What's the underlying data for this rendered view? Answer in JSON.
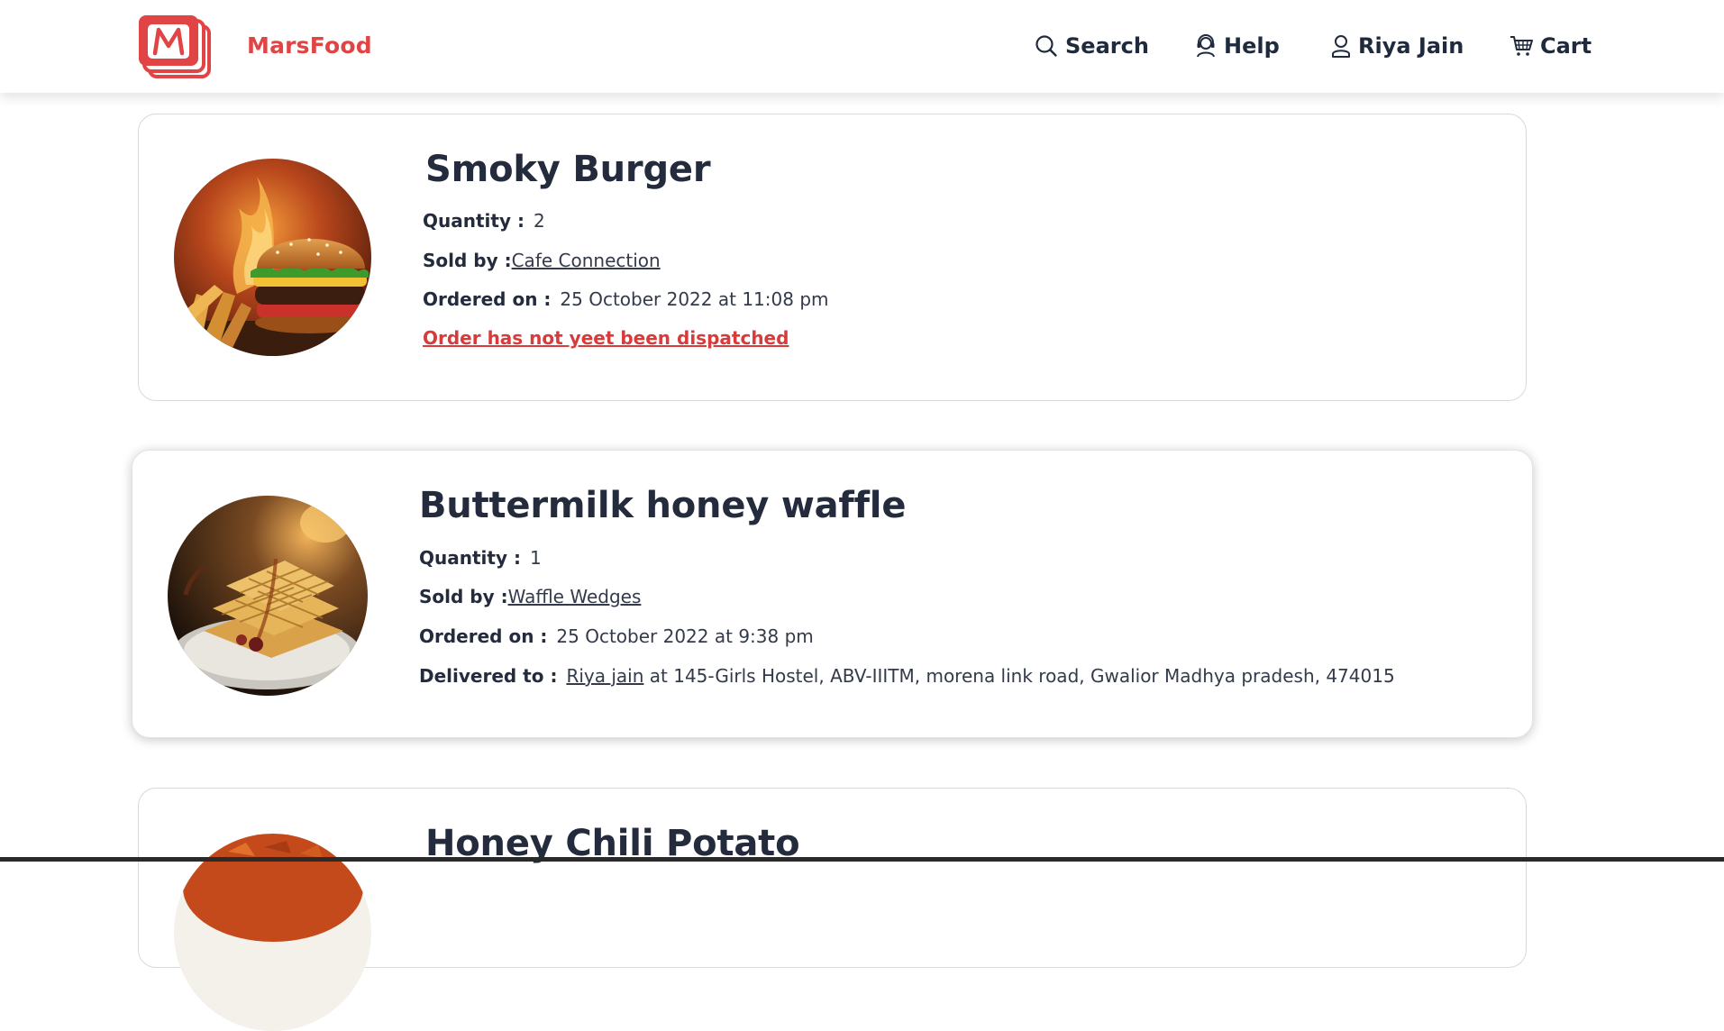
{
  "brand": {
    "name": "MarsFood",
    "accent_color": "#e04444"
  },
  "nav": {
    "search_label": "Search",
    "help_label": "Help",
    "user_label": "Riya Jain",
    "cart_label": "Cart"
  },
  "orders": [
    {
      "title": "Smoky Burger",
      "image_icon": "burger-photo",
      "quantity_label": "Quantity :",
      "quantity": "2",
      "sold_by_label": "Sold by :",
      "seller": "Cafe Connection",
      "ordered_on_label": "Ordered on :",
      "ordered_on": "25 October 2022 at 11:08 pm",
      "status": "Order has not yeet been dispatched",
      "status_color": "#d93a3a"
    },
    {
      "title": "Buttermilk honey waffle",
      "image_icon": "waffle-photo",
      "quantity_label": "Quantity :",
      "quantity": "1",
      "sold_by_label": "Sold by :",
      "seller": "Waffle Wedges",
      "ordered_on_label": "Ordered on :",
      "ordered_on": "25 October 2022 at 9:38 pm",
      "delivered_to_label": "Delivered to :",
      "delivered_name": "Riya jain",
      "delivered_address": "at 145-Girls Hostel, ABV-IIITM, morena link road, Gwalior Madhya pradesh, 474015"
    },
    {
      "title": "Honey Chili Potato",
      "image_icon": "chili-potato-photo"
    }
  ]
}
